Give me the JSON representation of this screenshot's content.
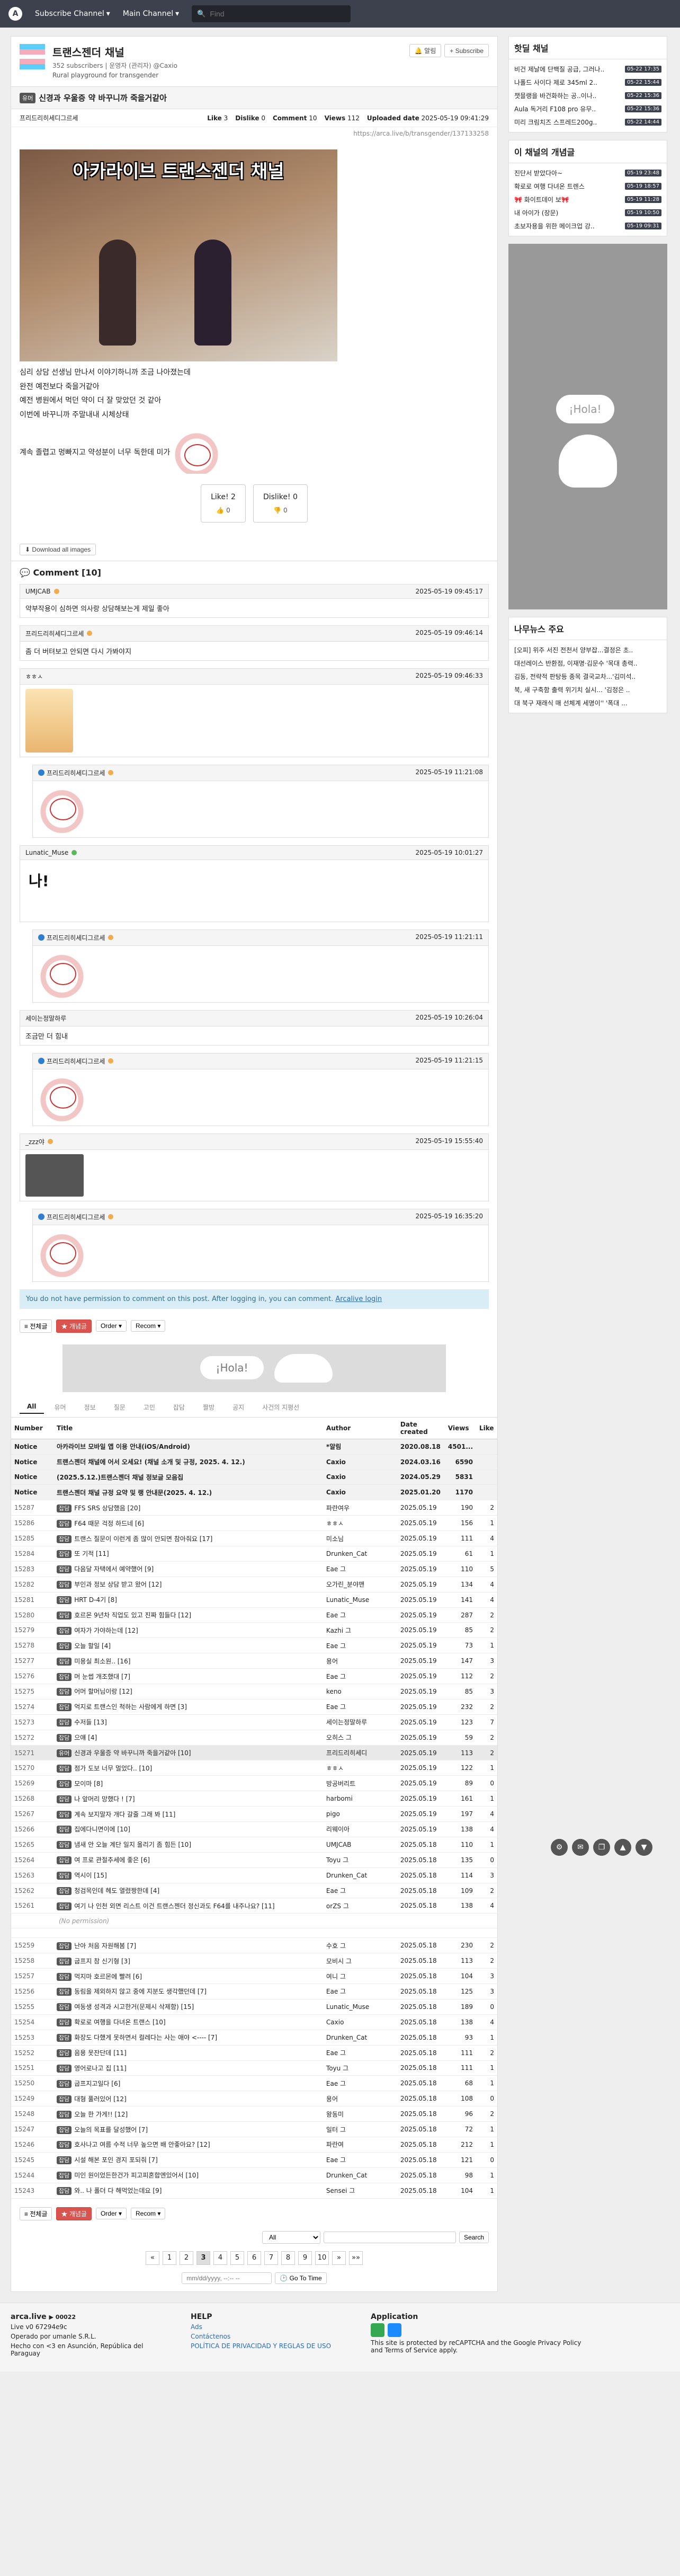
{
  "topbar": {
    "subscribe": "Subscribe Channel",
    "main": "Main Channel",
    "search_placeholder": "Find"
  },
  "channel": {
    "title": "트랜스젠더 채널",
    "subs": "352 subscribers",
    "sep": "|",
    "mgr_label": "운영자 (관리자)",
    "mgr": "@Caxio",
    "desc": "Rural playground for transgender",
    "btn_alarm": "알림",
    "btn_sub": "Subscribe"
  },
  "article": {
    "cat": "유머",
    "title": "신경과 우울증 약 바꾸니까 죽을거같아",
    "author": "프리드리히세디그르세",
    "like_label": "Like",
    "like": "3",
    "dislike_label": "Dislike",
    "dislike": "0",
    "comment_label": "Comment",
    "comment": "10",
    "views_label": "Views",
    "views": "112",
    "uploaded_label": "Uploaded date",
    "uploaded": "2025-05-19 09:41:29",
    "link": "https://arca.live/b/transgender/137133258",
    "image_text": "아카라이브 트랜스젠더 채널",
    "lines": [
      "심리 상담 선생님 만나서 이야기하니까 조금 나아졌는데",
      "완전 예전보다 죽을거같아",
      "예전 병원에서 먹던 약이 더 잘 맞았던 것 같아",
      "이번에 바꾸니까 주말내내 시체상태",
      "계속 졸렵고 멍빠지고 약성분이 너무 독한데 미가"
    ],
    "vote_like": "Like! 2",
    "vote_like_sub": "👍 0",
    "vote_dislike": "Dislike! 0",
    "vote_dislike_sub": "👎 0",
    "download": "Download all images"
  },
  "comments_header": "Comment [10]",
  "comments": [
    {
      "name": "UMJCAB",
      "date": "2025-05-19 09:45:17",
      "text": "약부작용이 심하면 의사랑 상담해보는게 제일 좋아"
    },
    {
      "name": "프리드리히세디그르세",
      "date": "2025-05-19 09:46:14",
      "text": "좀 더 버텨보고 안되면 다시 가봐야지"
    },
    {
      "name": "ㅎㅎㅅ",
      "date": "2025-05-19 09:46:33",
      "text": ""
    },
    {
      "name": "프리드리히세디그르세",
      "date": "2025-05-19 11:21:08",
      "text": ""
    },
    {
      "name": "Lunatic_Muse",
      "date": "2025-05-19 10:01:27",
      "text": ""
    },
    {
      "name": "프리드리히세디그르세",
      "date": "2025-05-19 11:21:11",
      "text": ""
    },
    {
      "name": "세이는정말하루",
      "date": "2025-05-19 10:26:04",
      "text": "조금만 더 힘내"
    },
    {
      "name": "프리드리히세디그르세",
      "date": "2025-05-19 11:21:15",
      "text": ""
    },
    {
      "name": "_zzz야",
      "date": "2025-05-19 15:55:40",
      "text": ""
    },
    {
      "name": "프리드리히세디그르세",
      "date": "2025-05-19 16:35:20",
      "text": ""
    }
  ],
  "notice": {
    "text": "You do not have permission to comment on this post. After logging in, you can comment.",
    "link": "Arcalive login"
  },
  "toolbar": {
    "all": "전체글",
    "best": "개념글",
    "order": "Order",
    "recom": "Recom"
  },
  "tabs": [
    "All",
    "유머",
    "정보",
    "질문",
    "고민",
    "잡담",
    "짤방",
    "공지",
    "사건의 지평선"
  ],
  "table_headers": {
    "number": "Number",
    "title": "Title",
    "author": "Author",
    "date": "Date created",
    "views": "Views",
    "like": "Like"
  },
  "notice_rows": [
    {
      "n": "Notice",
      "t": "아카라이브 모바일 앱 이용 안내(iOS/Android)",
      "a": "*알림",
      "d": "2020.08.18",
      "v": "4501...",
      "l": ""
    },
    {
      "n": "Notice",
      "t": "트랜스젠더 채널에 어서 오세요! (채널 소개 및 규정, 2025. 4. 12.)",
      "a": "Caxio",
      "d": "2024.03.16",
      "v": "6590",
      "l": ""
    },
    {
      "n": "Notice",
      "t": "(2025.5.12.)트랜스젠더 채널 정보글 모음집",
      "a": "Caxio",
      "d": "2024.05.29",
      "v": "5831",
      "l": ""
    },
    {
      "n": "Notice",
      "t": "트랜스젠더 채널 규정 요약 및 랭 안내문(2025. 4. 12.)",
      "a": "Caxio",
      "d": "2025.01.20",
      "v": "1170",
      "l": ""
    }
  ],
  "rows": [
    {
      "n": "15287",
      "c": "잡담",
      "t": "FFS SRS 상담했음 [20]",
      "a": "파란여우",
      "d": "2025.05.19",
      "v": "190",
      "l": "2"
    },
    {
      "n": "15286",
      "c": "잡담",
      "t": "F64 때문 걱정 하드네 [6]",
      "a": "ㅎㅎㅅ",
      "d": "2025.05.19",
      "v": "156",
      "l": "1"
    },
    {
      "n": "15285",
      "c": "잡담",
      "t": "트랜스 질문이 이런게 좀 많이 안되면 참아줘요 [17]",
      "a": "미소님",
      "d": "2025.05.19",
      "v": "111",
      "l": "4"
    },
    {
      "n": "15284",
      "c": "잡담",
      "t": "또 기적 [11]",
      "a": "Drunken_Cat",
      "d": "2025.05.19",
      "v": "61",
      "l": "1"
    },
    {
      "n": "15283",
      "c": "잡담",
      "t": "다음달 자택에서 예약했어 [9]",
      "a": "Eae 그",
      "d": "2025.05.19",
      "v": "110",
      "l": "5"
    },
    {
      "n": "15282",
      "c": "잡담",
      "t": "부인과 정보 상담 받고 왔어 [12]",
      "a": "오가린_분야맨",
      "d": "2025.05.19",
      "v": "134",
      "l": "4"
    },
    {
      "n": "15281",
      "c": "잡담",
      "t": "HRT D-4기 [8]",
      "a": "Lunatic_Muse",
      "d": "2025.05.19",
      "v": "141",
      "l": "4"
    },
    {
      "n": "15280",
      "c": "잡담",
      "t": "호르몬 9년차 직업도 있고 진짜 힘들다 [12]",
      "a": "Eae 그",
      "d": "2025.05.19",
      "v": "287",
      "l": "2"
    },
    {
      "n": "15279",
      "c": "잡담",
      "t": "여자가 가야하는데 [12]",
      "a": "Kazhi 그",
      "d": "2025.05.19",
      "v": "85",
      "l": "2"
    },
    {
      "n": "15278",
      "c": "잡담",
      "t": "오늘 할일 [4]",
      "a": "Eae 그",
      "d": "2025.05.19",
      "v": "73",
      "l": "1"
    },
    {
      "n": "15277",
      "c": "잡담",
      "t": "미용실 최소원.. [16]",
      "a": "용어",
      "d": "2025.05.19",
      "v": "147",
      "l": "3"
    },
    {
      "n": "15276",
      "c": "잡담",
      "t": "머 눈썹 개조했대 [7]",
      "a": "Eae 그",
      "d": "2025.05.19",
      "v": "112",
      "l": "2"
    },
    {
      "n": "15275",
      "c": "잡담",
      "t": "어머 할머님이랑 [12]",
      "a": "keno",
      "d": "2025.05.19",
      "v": "85",
      "l": "3"
    },
    {
      "n": "15274",
      "c": "잡담",
      "t": "억지로 트랜스인 척하는 사람에게 하면 [3]",
      "a": "Eae 그",
      "d": "2025.05.19",
      "v": "232",
      "l": "2"
    },
    {
      "n": "15273",
      "c": "잡담",
      "t": "수저들 [13]",
      "a": "세이는정말하루",
      "d": "2025.05.19",
      "v": "123",
      "l": "7"
    },
    {
      "n": "15272",
      "c": "잡담",
      "t": "으얘 [4]",
      "a": "오히스 그",
      "d": "2025.05.19",
      "v": "59",
      "l": "2"
    },
    {
      "n": "15271",
      "c": "유머",
      "t": "신경과 우울증 약 바꾸니까 죽을거같아 [10]",
      "a": "프리드리히세디",
      "d": "2025.05.19",
      "v": "113",
      "l": "2",
      "hl": true
    },
    {
      "n": "15270",
      "c": "잡담",
      "t": "점가 도보 너무 멀었다.. [10]",
      "a": "ㅎㅎㅅ",
      "d": "2025.05.19",
      "v": "122",
      "l": "1"
    },
    {
      "n": "15269",
      "c": "잡담",
      "t": "모이마 [8]",
      "a": "방공버리트",
      "d": "2025.05.19",
      "v": "89",
      "l": "0"
    },
    {
      "n": "15268",
      "c": "잡담",
      "t": "나 앞머리 망했다 ! [7]",
      "a": "harbomi",
      "d": "2025.05.19",
      "v": "161",
      "l": "1"
    },
    {
      "n": "15267",
      "c": "잡담",
      "t": "계속 보지말자 개다 갈줄 그래 봐 [11]",
      "a": "pigo",
      "d": "2025.05.19",
      "v": "197",
      "l": "4"
    },
    {
      "n": "15266",
      "c": "잡담",
      "t": "집에다니면이에 [10]",
      "a": "리웨이아",
      "d": "2025.05.19",
      "v": "138",
      "l": "4"
    },
    {
      "n": "15265",
      "c": "잡담",
      "t": "냄새 안 오늘 계단 일지 올리기 좀 힘든 [10]",
      "a": "UMJCAB",
      "d": "2025.05.18",
      "v": "110",
      "l": "1"
    },
    {
      "n": "15264",
      "c": "잡담",
      "t": "여 프로 관절추세에 좋은 [6]",
      "a": "Toyu 그",
      "d": "2025.05.18",
      "v": "135",
      "l": "0"
    },
    {
      "n": "15263",
      "c": "잡담",
      "t": "역시이 [15]",
      "a": "Drunken_Cat",
      "d": "2025.05.18",
      "v": "114",
      "l": "3"
    },
    {
      "n": "15262",
      "c": "잡담",
      "t": "청검목인데 헤도 열렸짱한데 [4]",
      "a": "Eae 그",
      "d": "2025.05.18",
      "v": "109",
      "l": "2"
    },
    {
      "n": "15261",
      "c": "잡담",
      "t": "여기 나 인천 외면 리스트 이건 트랜스젠더 정신과도 F64를 내주나요? [11]",
      "a": "orZS 그",
      "d": "2025.05.18",
      "v": "138",
      "l": "4"
    },
    {
      "perm": true,
      "t": "(No permission)"
    },
    {
      "sep": true
    },
    {
      "n": "15259",
      "c": "잡담",
      "t": "난아 처음 자원해봄 [7]",
      "a": "수호 그",
      "d": "2025.05.18",
      "v": "230",
      "l": "2"
    },
    {
      "n": "15258",
      "c": "잡담",
      "t": "굽프지 참 신기형 [3]",
      "a": "모비시 그",
      "d": "2025.05.18",
      "v": "113",
      "l": "2"
    },
    {
      "n": "15257",
      "c": "잡담",
      "t": "먹지마 호르몬에 빨려 [6]",
      "a": "여니 그",
      "d": "2025.05.18",
      "v": "104",
      "l": "3"
    },
    {
      "n": "15256",
      "c": "잡담",
      "t": "동림을 제외하지 않고 중에 지분도 생각했던데 [7]",
      "a": "Eae 그",
      "d": "2025.05.18",
      "v": "125",
      "l": "3"
    },
    {
      "n": "15255",
      "c": "잡담",
      "t": "여동생 성격과 시고한거(문제시 삭제함) [15]",
      "a": "Lunatic_Muse",
      "d": "2025.05.18",
      "v": "189",
      "l": "0"
    },
    {
      "n": "15254",
      "c": "잡담",
      "t": "확로로 여행을 다녀온 트랜스 [10]",
      "a": "Caxio",
      "d": "2025.05.18",
      "v": "138",
      "l": "4"
    },
    {
      "n": "15253",
      "c": "잡담",
      "t": "화장도 다했게 못하면서 컬레다는 사는 애야 <---- [7]",
      "a": "Drunken_Cat",
      "d": "2025.05.18",
      "v": "93",
      "l": "1"
    },
    {
      "n": "15252",
      "c": "잡담",
      "t": "음용 못잔단데 [11]",
      "a": "Eae 그",
      "d": "2025.05.18",
      "v": "111",
      "l": "2"
    },
    {
      "n": "15251",
      "c": "잡담",
      "t": "영어로나고 집 [11]",
      "a": "Toyu 그",
      "d": "2025.05.18",
      "v": "111",
      "l": "1"
    },
    {
      "n": "15250",
      "c": "잡담",
      "t": "굽프지고일다 [6]",
      "a": "Eae 그",
      "d": "2025.05.18",
      "v": "68",
      "l": "1"
    },
    {
      "n": "15249",
      "c": "잡담",
      "t": "대형 풀러있어 [12]",
      "a": "용어",
      "d": "2025.05.18",
      "v": "108",
      "l": "0"
    },
    {
      "n": "15248",
      "c": "잡담",
      "t": "오늘 한 가게!! [12]",
      "a": "왕동미",
      "d": "2025.05.18",
      "v": "96",
      "l": "2"
    },
    {
      "n": "15247",
      "c": "잡담",
      "t": "오늘의 목표를 달성했어 [7]",
      "a": "일터 그",
      "d": "2025.05.18",
      "v": "72",
      "l": "1"
    },
    {
      "n": "15246",
      "c": "잡담",
      "t": "호사나고 여름 수적 너무 높으면 배 안좋아요? [12]",
      "a": "파란여",
      "d": "2025.05.18",
      "v": "212",
      "l": "1"
    },
    {
      "n": "15245",
      "c": "잡담",
      "t": "시설 해본 포인 경지 포되줘 [7]",
      "a": "Eae 그",
      "d": "2025.05.18",
      "v": "121",
      "l": "0"
    },
    {
      "n": "15244",
      "c": "잡담",
      "t": "미인 원이었든한건가 피고피혼합엔있어서 [10]",
      "a": "Drunken_Cat",
      "d": "2025.05.18",
      "v": "98",
      "l": "1"
    },
    {
      "n": "15243",
      "c": "잡담",
      "t": "와.. 나 폴더 다 해먹었는데요 [9]",
      "a": "Sensei 그",
      "d": "2025.05.18",
      "v": "104",
      "l": "1"
    }
  ],
  "bottom": {
    "all_option": "All",
    "search": "Search",
    "date_placeholder": "mm/dd/yyyy, --:-- --",
    "goto": "Go To Time"
  },
  "pager": [
    "«",
    "1",
    "2",
    "3",
    "4",
    "5",
    "6",
    "7",
    "8",
    "9",
    "10",
    "»",
    "»»"
  ],
  "pager_current": "3",
  "side": {
    "hot_title": "핫딜 채널",
    "hot": [
      {
        "t": "비건 제날에 단백질 공급, 그러나..",
        "time": "05-22 17:35"
      },
      {
        "t": "나폴드 사이다 제로 345ml 2..",
        "time": "05-22 15:44"
      },
      {
        "t": "챗믈랭을 바건화하는 공..이나..",
        "time": "05-22 15:36"
      },
      {
        "t": "Aula 독거리 F108 pro 유무..",
        "time": "05-22 15:36"
      },
      {
        "t": "미리 크림치즈 스프레드200g..",
        "time": "05-22 14:44"
      }
    ],
    "concept_title": "이 채널의 개념글",
    "concept": [
      {
        "t": "진단서 받았다아~",
        "time": "05-19 23:48"
      },
      {
        "t": "확로로 여행 다녀온 트렌스",
        "time": "05-19 18:57"
      },
      {
        "t": "🎀 화이트데이 보🎀",
        "time": "05-19 11:28"
      },
      {
        "t": "내 아이가 (장문)",
        "time": "05-19 10:50"
      },
      {
        "t": "초보자용을 위한 메이크업 강..",
        "time": "05-19 09:31"
      }
    ],
    "news_title": "나무뉴스 주요",
    "news": [
      "[오피] 위주 서진 전천서 양부잡...결정은 초..",
      "대선레이스 반환점, 이재명·김문수 '목대 총력..",
      "김동, 전략적 판탕등 종목 결국교차...'김미석..",
      "북, 새 구축함 출력 위기치 실시... '김정은 ..",
      "대 북구 재래식 매 선체계 세명이'' '폭대 ..."
    ]
  },
  "footer": {
    "brand": "arca.live",
    "brand_sub": "▶ 00022",
    "live": "Live v0 67294e9c",
    "operated": "Operado por umanle S.R.L.",
    "addr": "Hecho con <3 en Asunción, República del Paraguay",
    "help": "HELP",
    "ads": "Ads",
    "contact": "Contáctenos",
    "policy": "POLÍTICA DE PRIVACIDAD Y REGLAS DE USO",
    "app": "Application",
    "captcha": "This site is protected by reCAPTCHA and the Google Privacy Policy and Terms of Service apply."
  }
}
